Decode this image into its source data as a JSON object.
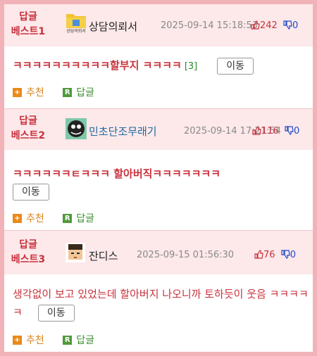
{
  "posts": [
    {
      "badge_line1": "답글",
      "badge_line2": "베스트1",
      "avatar_icon": "folder-doc-icon",
      "avatar_caption": "상담의뢰서",
      "nickname": "상담의뢰서",
      "date": "2025-09-14 15:18:53",
      "up_count": "242",
      "down_count": "0",
      "content": "ㅋㅋㅋㅋㅋㅋㅋㅋㅋㅋ할부지 ㅋㅋㅋㅋ",
      "reply_count": "[3]",
      "move_label": "이동",
      "recommend_label": "추천",
      "reply_label": "답글"
    },
    {
      "badge_line1": "답글",
      "badge_line2": "베스트2",
      "avatar_icon": "creature-icon",
      "nickname": "민초단조무래기",
      "date": "2025-09-14 17:21:54",
      "up_count": "116",
      "down_count": "0",
      "content": "ㅋㅋㅋㅋㅋㅋㅌㅋㅋㅋ 할아버직ㅋㅋㅋㅋㅋㅋㅋ",
      "move_label": "이동",
      "recommend_label": "추천",
      "reply_label": "답글"
    },
    {
      "badge_line1": "답글",
      "badge_line2": "베스트3",
      "avatar_icon": "pixel-face-icon",
      "nickname": "잔디스",
      "date": "2025-09-15 01:56:30",
      "up_count": "76",
      "down_count": "0",
      "content": "생각없이 보고 있었는데 할아버지 나오니까 토하듯이 웃음 ㅋㅋㅋㅋㅋ",
      "move_label": "이동",
      "recommend_label": "추천",
      "reply_label": "답글"
    }
  ],
  "colors": {
    "frame": "#f2b3b8",
    "header_bg": "#fde8ea",
    "accent_red": "#c8323c",
    "down_blue": "#1f49c8",
    "recommend_orange": "#e98a19",
    "reply_green": "#4f9a3a"
  }
}
